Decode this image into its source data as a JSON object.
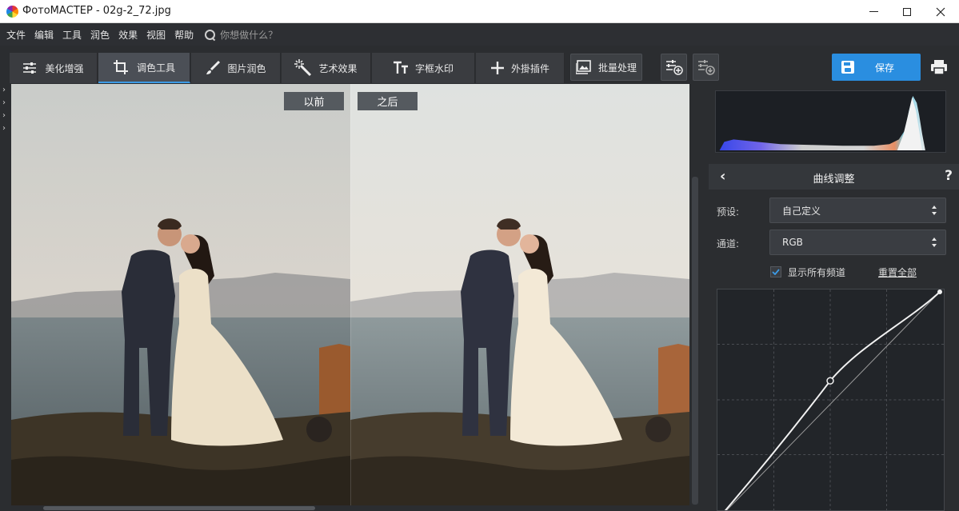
{
  "window": {
    "title": "ФотоМАСТЕР - 02g-2_72.jpg"
  },
  "menu": {
    "items": [
      "文件",
      "编辑",
      "工具",
      "润色",
      "效果",
      "视图",
      "帮助"
    ],
    "search_placeholder": "你想做什么？"
  },
  "tabs": [
    {
      "label": "美化增强",
      "icon": "sliders-icon"
    },
    {
      "label": "调色工具",
      "icon": "crop-icon",
      "active": true
    },
    {
      "label": "图片润色",
      "icon": "brush-icon"
    },
    {
      "label": "艺术效果",
      "icon": "magic-wand-icon"
    },
    {
      "label": "字框水印",
      "icon": "text-icon"
    },
    {
      "label": "外掛插件",
      "icon": "plus-icon"
    }
  ],
  "toolbar": {
    "batch_label": "批量处理",
    "save_label": "保存"
  },
  "compare": {
    "before_label": "以前",
    "after_label": "之后"
  },
  "panel": {
    "title": "曲线调整",
    "preset_label": "预设:",
    "preset_value": "自己定义",
    "channel_label": "通道:",
    "channel_value": "RGB",
    "show_all_label": "显示所有频道",
    "show_all_checked": true,
    "reset_label": "重置全部"
  },
  "colors": {
    "accent": "#2a8ee0",
    "background": "#2b2d30"
  }
}
